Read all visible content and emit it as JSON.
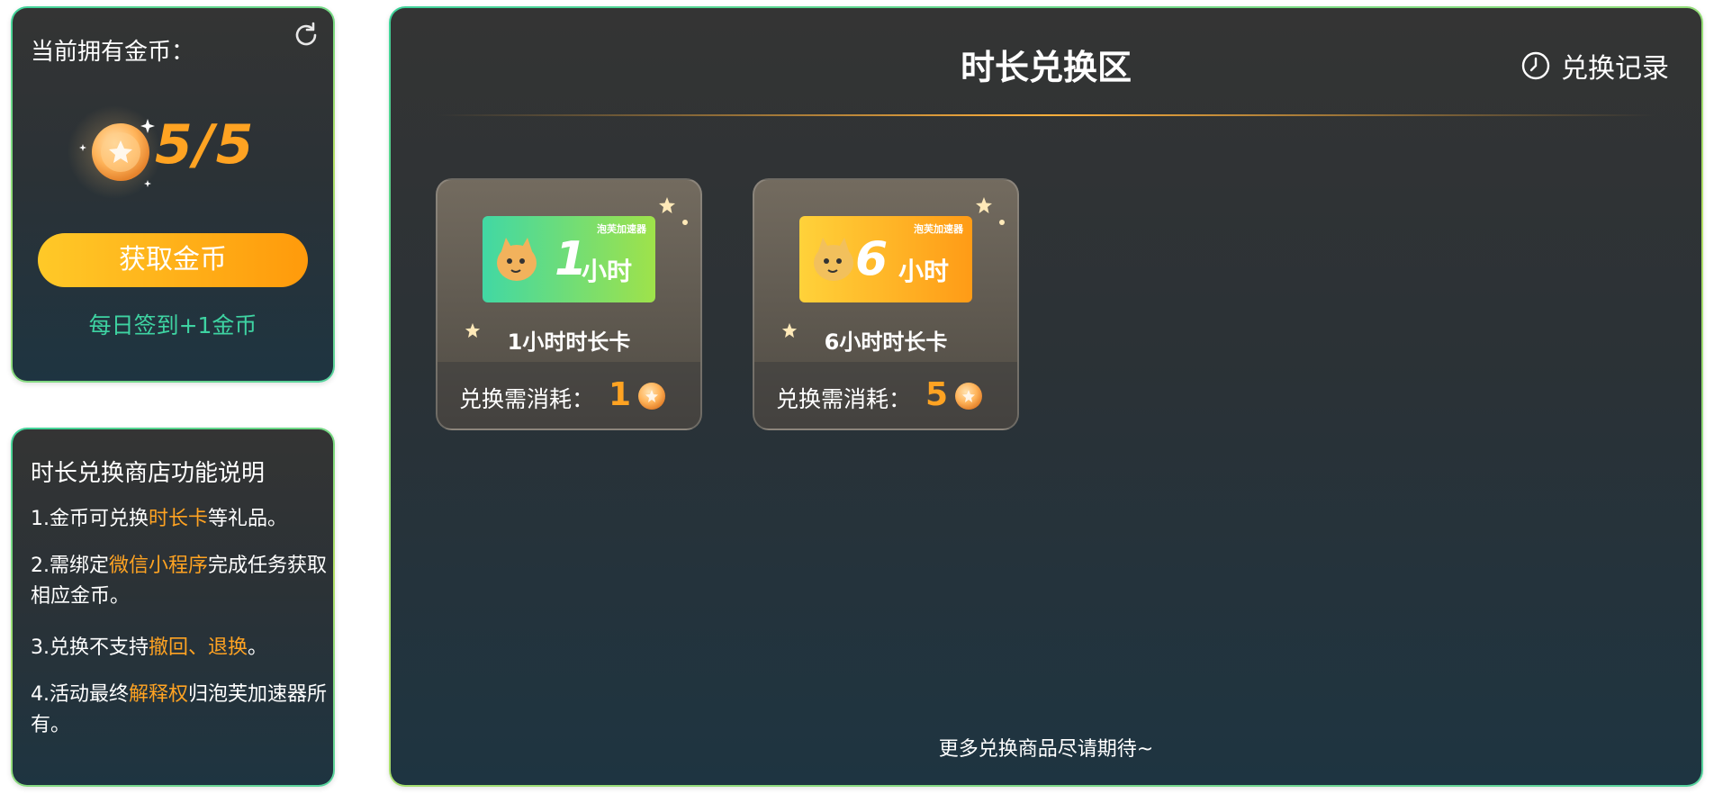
{
  "coin_panel": {
    "title": "当前拥有金币：",
    "count": "5/5",
    "get_button": "获取金币",
    "checkin": "每日签到+1金币"
  },
  "desc_panel": {
    "title": "时长兑换商店功能说明",
    "items": [
      {
        "pre": "1.金币可兑换",
        "hl": "时长卡",
        "post": "等礼品。"
      },
      {
        "pre": "2.需绑定",
        "hl": "微信小程序",
        "post": "完成任务获取相应金币。"
      },
      {
        "pre": "3.兑换不支持",
        "hl": "撤回、退换",
        "post": "。"
      },
      {
        "pre": "4.活动最终",
        "hl": "解释权",
        "post": "归泡芙加速器所有。"
      }
    ]
  },
  "main": {
    "title": "时长兑换区",
    "history": "兑换记录",
    "footer": "更多兑换商品尽请期待~",
    "cards": [
      {
        "name": "1小时时长卡",
        "ticket_num": "1",
        "ticket_unit": "小时",
        "ticket_brand": "泡芙加速器",
        "cost_label": "兑换需消耗：",
        "cost": "1",
        "theme": "green"
      },
      {
        "name": "6小时时长卡",
        "ticket_num": "6",
        "ticket_unit": "小时",
        "ticket_brand": "泡芙加速器",
        "cost_label": "兑换需消耗：",
        "cost": "5",
        "theme": "yellow"
      }
    ]
  },
  "colors": {
    "accent": "#ffa322",
    "green_text": "#3ed3a2",
    "border_gradient": "#46d29a"
  },
  "icons": {
    "refresh": "refresh-icon",
    "history": "clock-history-icon",
    "coin": "coin-icon"
  }
}
